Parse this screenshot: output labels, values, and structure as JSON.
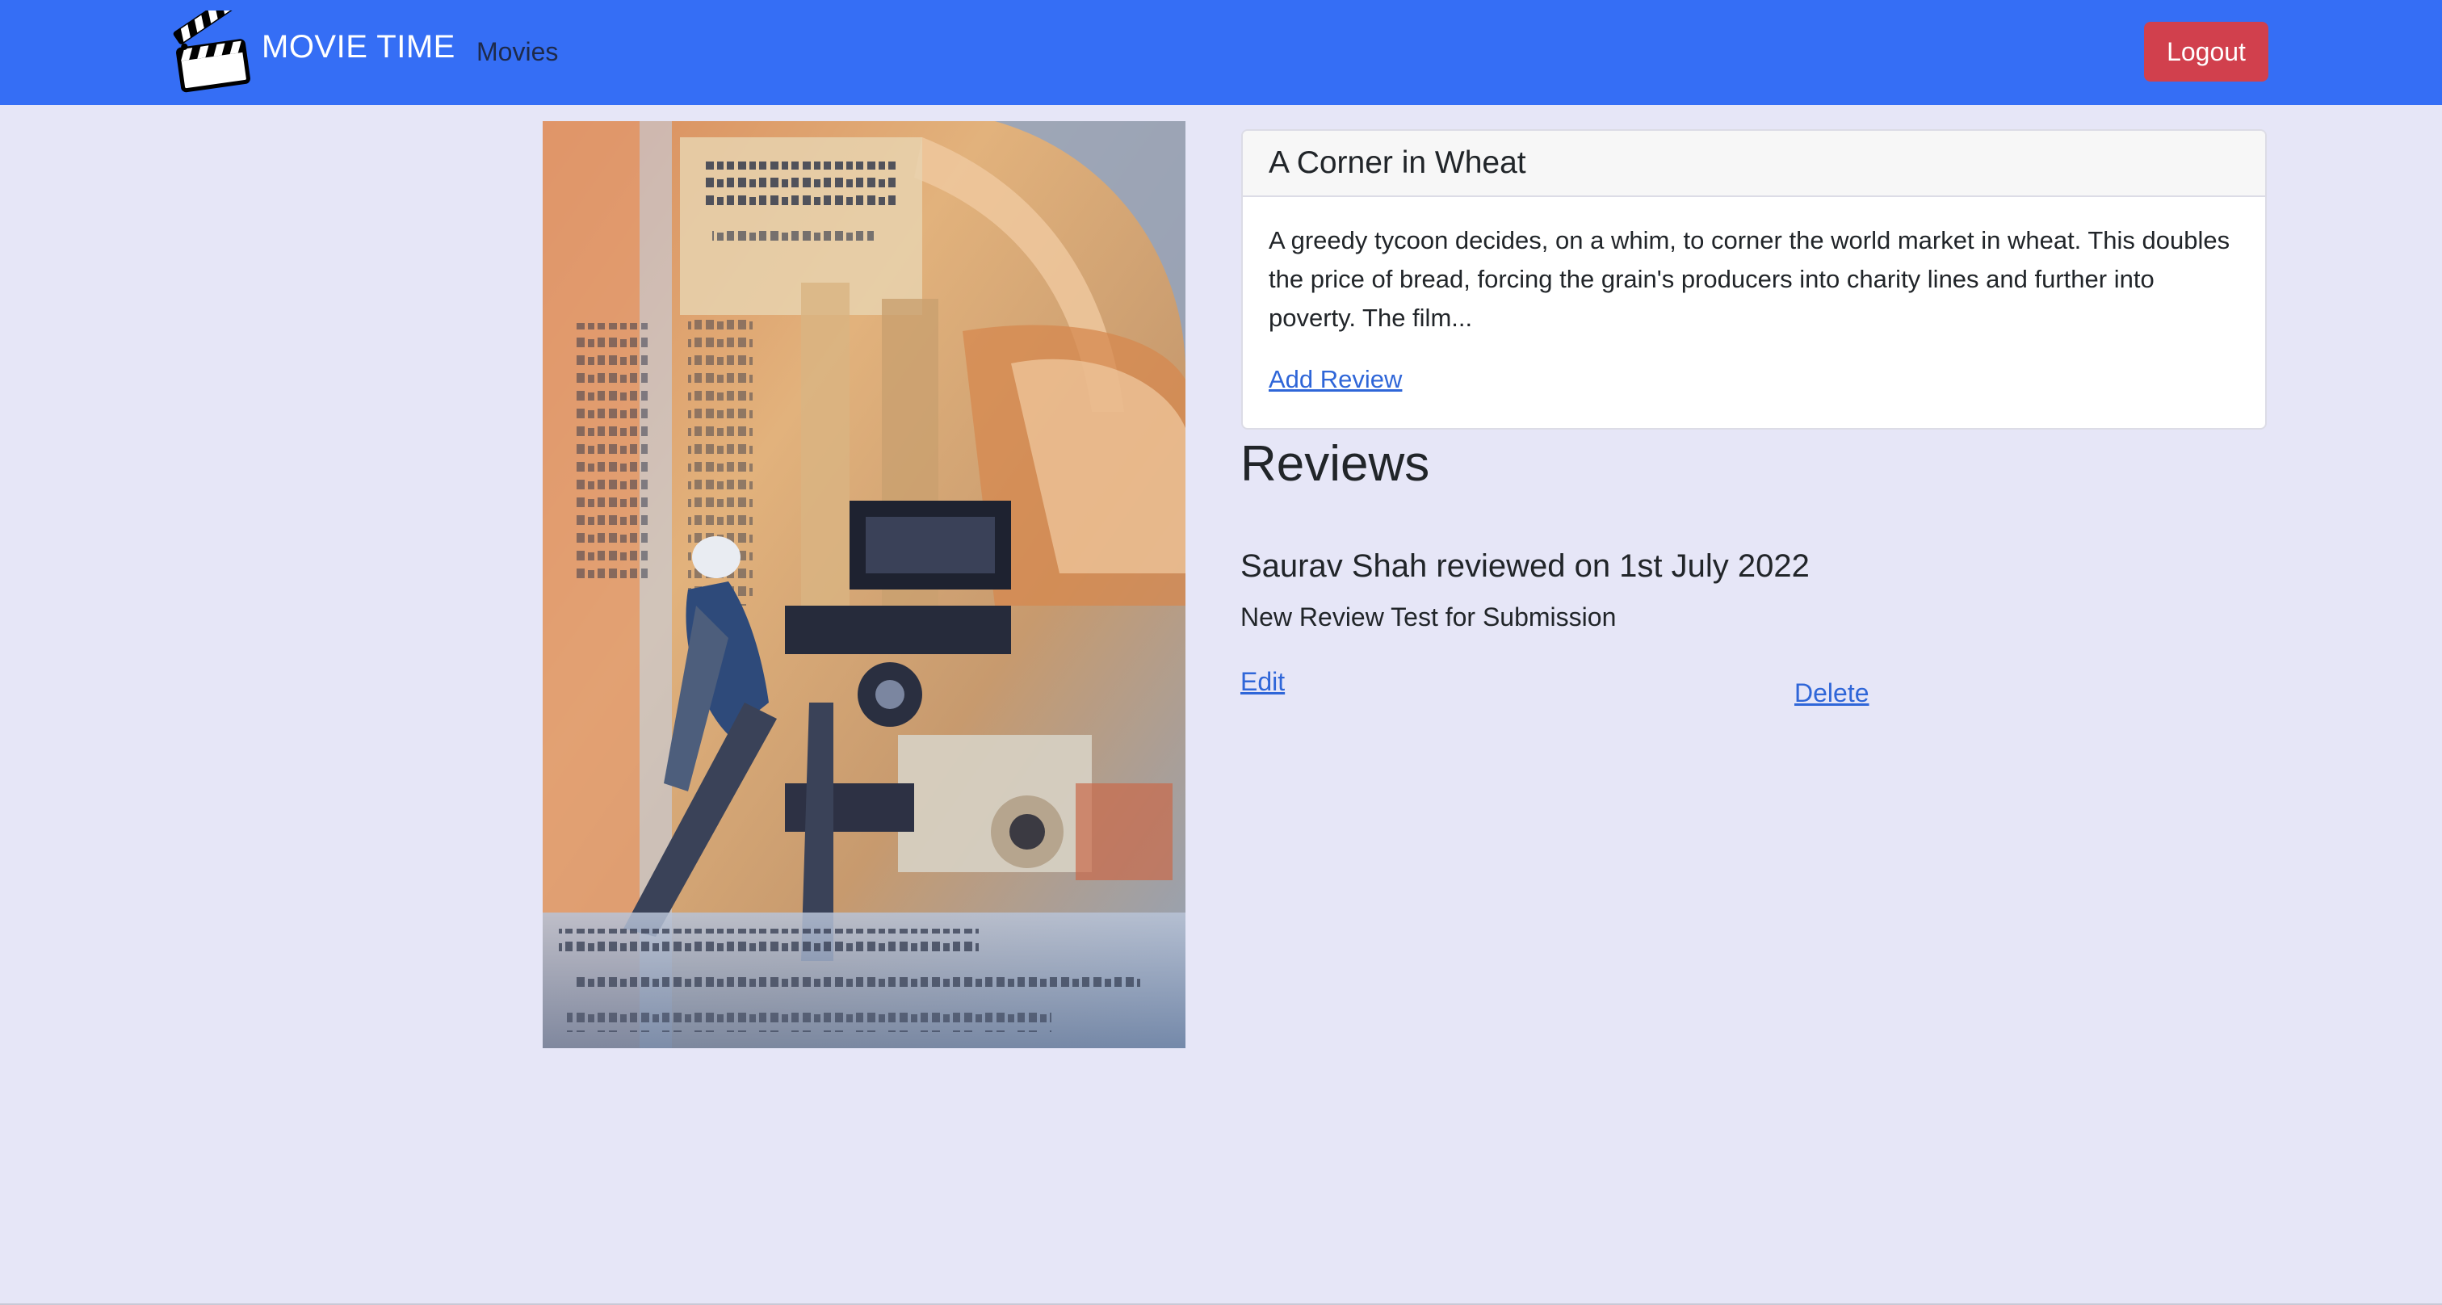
{
  "navbar": {
    "brand_text": "MOVIE TIME",
    "brand_icon": "clapperboard-icon",
    "nav_movies_label": "Movies",
    "logout_label": "Logout",
    "colors": {
      "navbar_bg": "#356ef5",
      "logout_bg": "#d1404d"
    }
  },
  "movie": {
    "poster_description": "movie-poster-image",
    "title": "A Corner in Wheat",
    "plot": "A greedy tycoon decides, on a whim, to corner the world market in wheat. This doubles the price of bread, forcing the grain's producers into charity lines and further into poverty. The film...",
    "add_review_label": "Add Review"
  },
  "reviews": {
    "heading": "Reviews",
    "items": [
      {
        "title": "Saurav Shah reviewed on 1st July 2022",
        "text": "New Review Test for Submission",
        "edit_label": "Edit",
        "delete_label": "Delete"
      }
    ]
  },
  "colors": {
    "page_bg": "#e6e6f7",
    "link": "#2f66d8"
  }
}
